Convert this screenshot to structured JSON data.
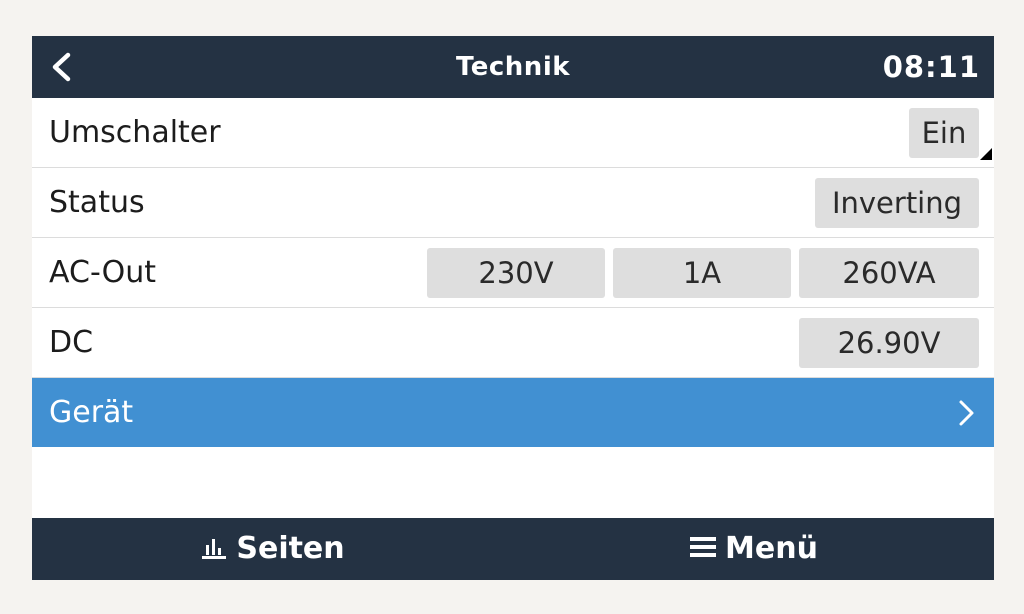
{
  "header": {
    "title": "Technik",
    "clock": "08:11",
    "back_icon": "chevron-left-icon"
  },
  "rows": {
    "switch": {
      "label": "Umschalter",
      "value": "Ein"
    },
    "status": {
      "label": "Status",
      "value": "Inverting"
    },
    "ac_out": {
      "label": "AC-Out",
      "voltage": "230V",
      "current": "1A",
      "power": "260VA"
    },
    "dc": {
      "label": "DC",
      "voltage": "26.90V"
    },
    "device": {
      "label": "Gerät",
      "icon": "chevron-right-icon"
    }
  },
  "footer": {
    "pages_label": "Seiten",
    "pages_icon": "bar-chart-icon",
    "menu_label": "Menü",
    "menu_icon": "hamburger-menu-icon"
  },
  "colors": {
    "bar_background": "#243243",
    "highlight": "#4190d2",
    "value_box": "#dedede"
  }
}
